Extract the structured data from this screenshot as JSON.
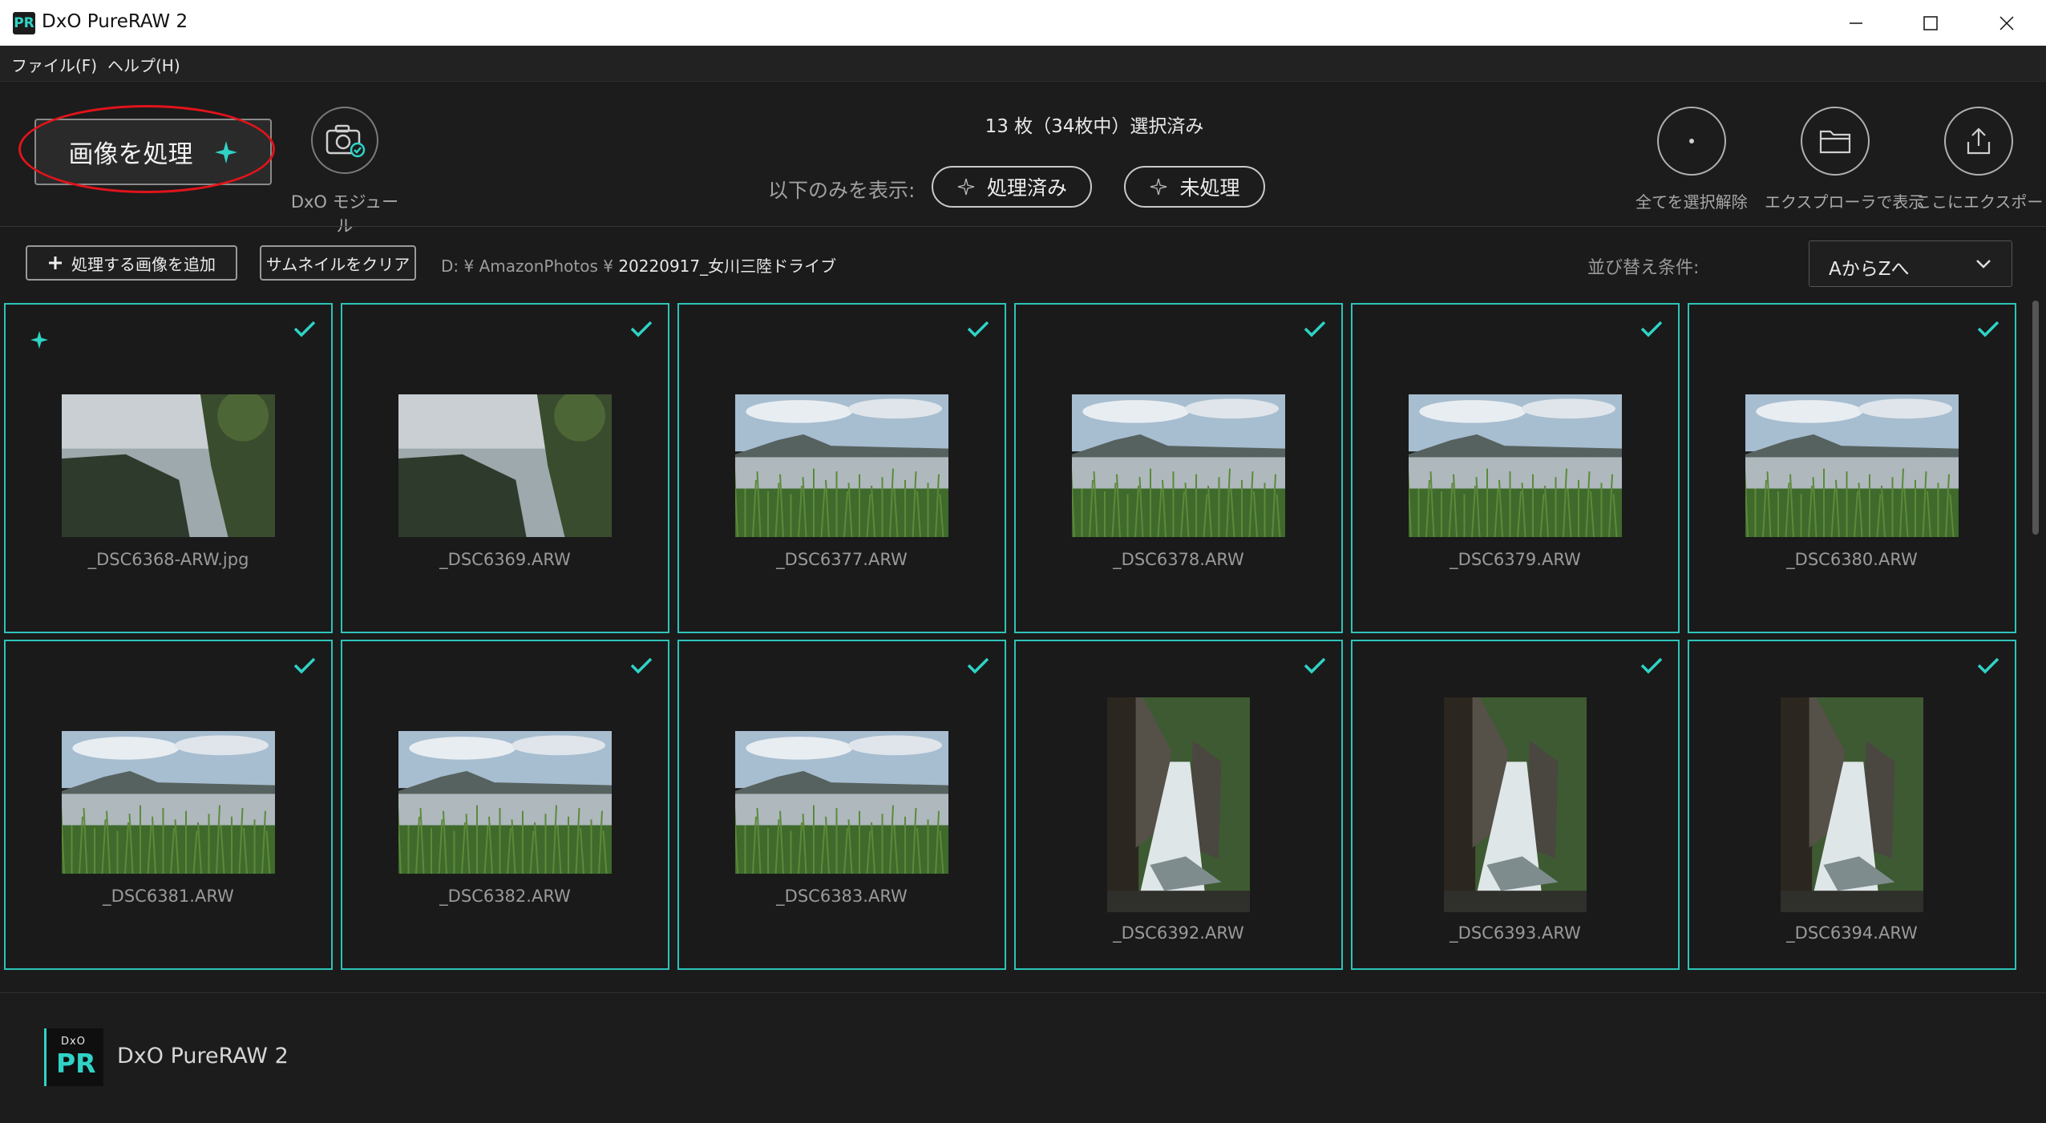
{
  "window": {
    "title": "DxO PureRAW 2",
    "app_icon_text": "PR"
  },
  "menu": {
    "file": "ファイル(F)",
    "help": "ヘルプ(H)"
  },
  "toolbar": {
    "process_label": "画像を処理",
    "module_label": "DxO モジュール",
    "selection_count": "13 枚（34枚中）選択済み",
    "show_only_label": "以下のみを表示:",
    "filter_processed": "処理済み",
    "filter_unprocessed": "未処理",
    "deselect_all": "全てを選択解除",
    "show_in_explorer": "エクスプローラで表示",
    "export_here": "ここにエクスポート..."
  },
  "subbar": {
    "add_images": "処理する画像を追加",
    "clear_thumbnails": "サムネイルをクリア",
    "path_prefix": "D: ¥ AmazonPhotos ¥ ",
    "path_folder": "20220917_女川三陸ドライブ",
    "sort_label": "並び替え条件:",
    "sort_value": "AからZへ"
  },
  "thumbnails": [
    {
      "filename": "_DSC6368-ARW.jpg",
      "scene": "coast",
      "processed": true,
      "selected": true
    },
    {
      "filename": "_DSC6369.ARW",
      "scene": "coast",
      "processed": false,
      "selected": true
    },
    {
      "filename": "_DSC6377.ARW",
      "scene": "lake",
      "processed": false,
      "selected": true
    },
    {
      "filename": "_DSC6378.ARW",
      "scene": "lake",
      "processed": false,
      "selected": true
    },
    {
      "filename": "_DSC6379.ARW",
      "scene": "lake",
      "processed": false,
      "selected": true
    },
    {
      "filename": "_DSC6380.ARW",
      "scene": "lake",
      "processed": false,
      "selected": true
    },
    {
      "filename": "_DSC6381.ARW",
      "scene": "lake",
      "processed": false,
      "selected": true
    },
    {
      "filename": "_DSC6382.ARW",
      "scene": "lake",
      "processed": false,
      "selected": true
    },
    {
      "filename": "_DSC6383.ARW",
      "scene": "lake",
      "processed": false,
      "selected": true
    },
    {
      "filename": "_DSC6392.ARW",
      "scene": "gorge",
      "processed": false,
      "selected": true
    },
    {
      "filename": "_DSC6393.ARW",
      "scene": "gorge",
      "processed": false,
      "selected": true
    },
    {
      "filename": "_DSC6394.ARW",
      "scene": "gorge",
      "processed": false,
      "selected": true
    }
  ],
  "footer": {
    "product_name": "DxO PureRAW 2",
    "logo_top": "DxO",
    "logo_main": "PR"
  },
  "colors": {
    "accent": "#2fd3c6",
    "tile_border": "#2cc4b8",
    "highlight_ellipse": "#e0141b",
    "background": "#1b1b1b"
  },
  "icons": {
    "process": "sparkle-icon",
    "module": "camera-check-icon",
    "deselect": "dot-circle-icon",
    "explorer": "folder-icon",
    "export": "upload-icon",
    "check": "check-icon",
    "sort": "chevron-down-icon"
  }
}
